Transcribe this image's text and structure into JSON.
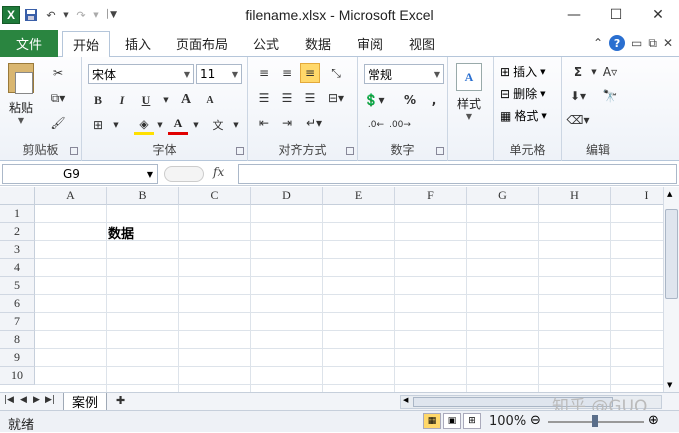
{
  "window": {
    "title": "filename.xlsx  -  Microsoft Excel"
  },
  "tabs": {
    "file": "文件",
    "items": [
      "开始",
      "插入",
      "页面布局",
      "公式",
      "数据",
      "审阅",
      "视图"
    ]
  },
  "ribbon": {
    "clipboard": {
      "label": "剪贴板",
      "paste": "粘贴"
    },
    "font": {
      "label": "字体",
      "name": "宋体",
      "size": "11",
      "bold": "B",
      "italic": "I",
      "underline": "U",
      "grow": "A",
      "shrink": "A"
    },
    "alignment": {
      "label": "对齐方式"
    },
    "number": {
      "label": "数字",
      "format": "常规",
      "percent": "%",
      "comma": ","
    },
    "styles": {
      "label": "样式"
    },
    "cells": {
      "label": "单元格",
      "insert": "插入",
      "delete": "删除",
      "format": "格式"
    },
    "editing": {
      "label": "编辑",
      "sum": "Σ"
    }
  },
  "formula_bar": {
    "name_box": "G9",
    "fx": "fx",
    "value": ""
  },
  "columns": [
    "A",
    "B",
    "C",
    "D",
    "E",
    "F",
    "G",
    "H",
    "I"
  ],
  "rows": [
    "1",
    "2",
    "3",
    "4",
    "5",
    "6",
    "7",
    "8",
    "9",
    "10"
  ],
  "cells": {
    "B2": "数据"
  },
  "sheets": {
    "active": "案例"
  },
  "status": {
    "ready": "就绪",
    "zoom": "100%"
  },
  "watermark": "知乎 @GUO"
}
